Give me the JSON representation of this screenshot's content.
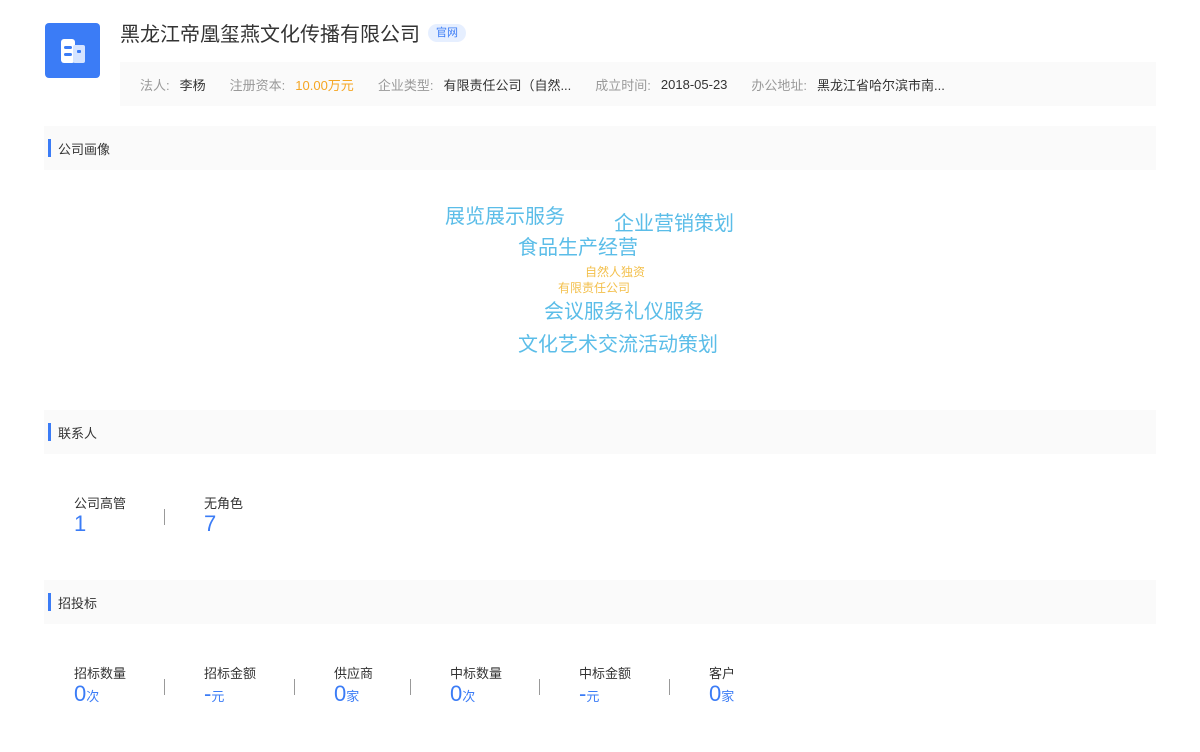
{
  "company": {
    "name": "黑龙江帝凰玺燕文化传播有限公司",
    "official_tag": "官网",
    "logo_icon": "building-icon"
  },
  "info": [
    {
      "key": "法人:",
      "value": "李杨",
      "highlight": false
    },
    {
      "key": "注册资本:",
      "value": "10.00万元",
      "highlight": true
    },
    {
      "key": "企业类型:",
      "value": "有限责任公司（自然...",
      "highlight": false
    },
    {
      "key": "成立时间:",
      "value": "2018-05-23",
      "highlight": false
    },
    {
      "key": "办公地址:",
      "value": "黑龙江省哈尔滨市南...",
      "highlight": false
    }
  ],
  "sections": {
    "portrait": "公司画像",
    "contacts": "联系人",
    "bidding": "招投标"
  },
  "word_cloud": [
    {
      "text": "展览展示服务",
      "color": "#5bbde8"
    },
    {
      "text": "企业营销策划",
      "color": "#5bbde8"
    },
    {
      "text": "食品生产经营",
      "color": "#5bbde8"
    },
    {
      "text": "自然人独资",
      "color": "#f3c04d"
    },
    {
      "text": "有限责任公司",
      "color": "#f3c04d"
    },
    {
      "text": "会议服务礼仪服务",
      "color": "#5bbde8"
    },
    {
      "text": "文化艺术交流活动策划",
      "color": "#5bbde8"
    }
  ],
  "contacts": [
    {
      "label": "公司高管",
      "value": "1"
    },
    {
      "label": "无角色",
      "value": "7"
    }
  ],
  "bidding": [
    {
      "label": "招标数量",
      "value": "0",
      "unit": "次"
    },
    {
      "label": "招标金额",
      "value": "-",
      "unit": "元"
    },
    {
      "label": "供应商",
      "value": "0",
      "unit": "家"
    },
    {
      "label": "中标数量",
      "value": "0",
      "unit": "次"
    },
    {
      "label": "中标金额",
      "value": "-",
      "unit": "元"
    },
    {
      "label": "客户",
      "value": "0",
      "unit": "家"
    }
  ],
  "colors": {
    "accent": "#3b7cf6",
    "highlight": "#f5a623",
    "cloud_blue": "#5bbde8",
    "cloud_yellow": "#f3c04d"
  }
}
